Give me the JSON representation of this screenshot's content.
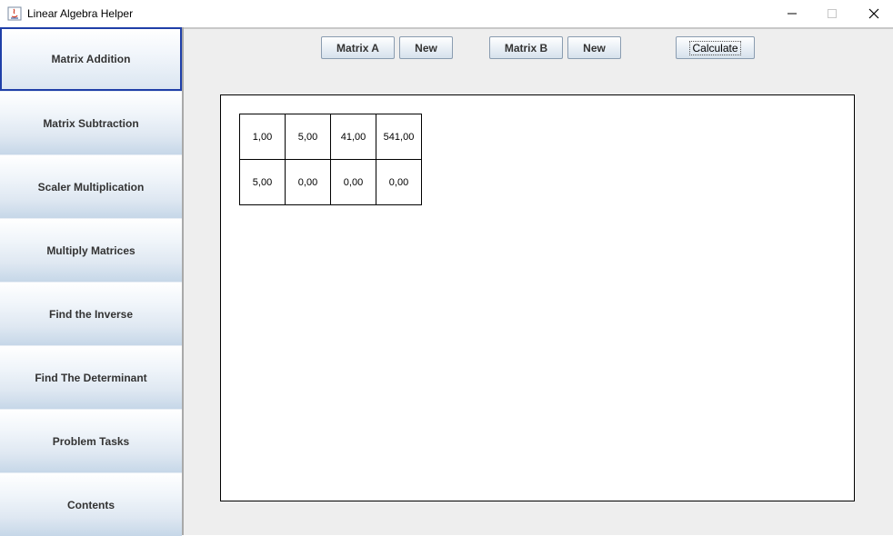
{
  "window": {
    "title": "Linear Algebra Helper"
  },
  "sidebar": {
    "items": [
      {
        "label": "Matrix Addition"
      },
      {
        "label": "Matrix Subtraction"
      },
      {
        "label": "Scaler Multiplication"
      },
      {
        "label": "Multiply Matrices"
      },
      {
        "label": "Find the Inverse"
      },
      {
        "label": "Find The Determinant"
      },
      {
        "label": "Problem Tasks"
      },
      {
        "label": "Contents"
      }
    ]
  },
  "toolbar": {
    "matrix_a": "Matrix A",
    "new_a": "New",
    "matrix_b": "Matrix B",
    "new_b": "New",
    "calculate": "Calculate"
  },
  "matrix": {
    "rows": [
      [
        "1,00",
        "5,00",
        "41,00",
        "541,00"
      ],
      [
        "5,00",
        "0,00",
        "0,00",
        "0,00"
      ]
    ]
  },
  "colors": {
    "active_border": "#1f3fa8",
    "background": "#eeeeee"
  }
}
